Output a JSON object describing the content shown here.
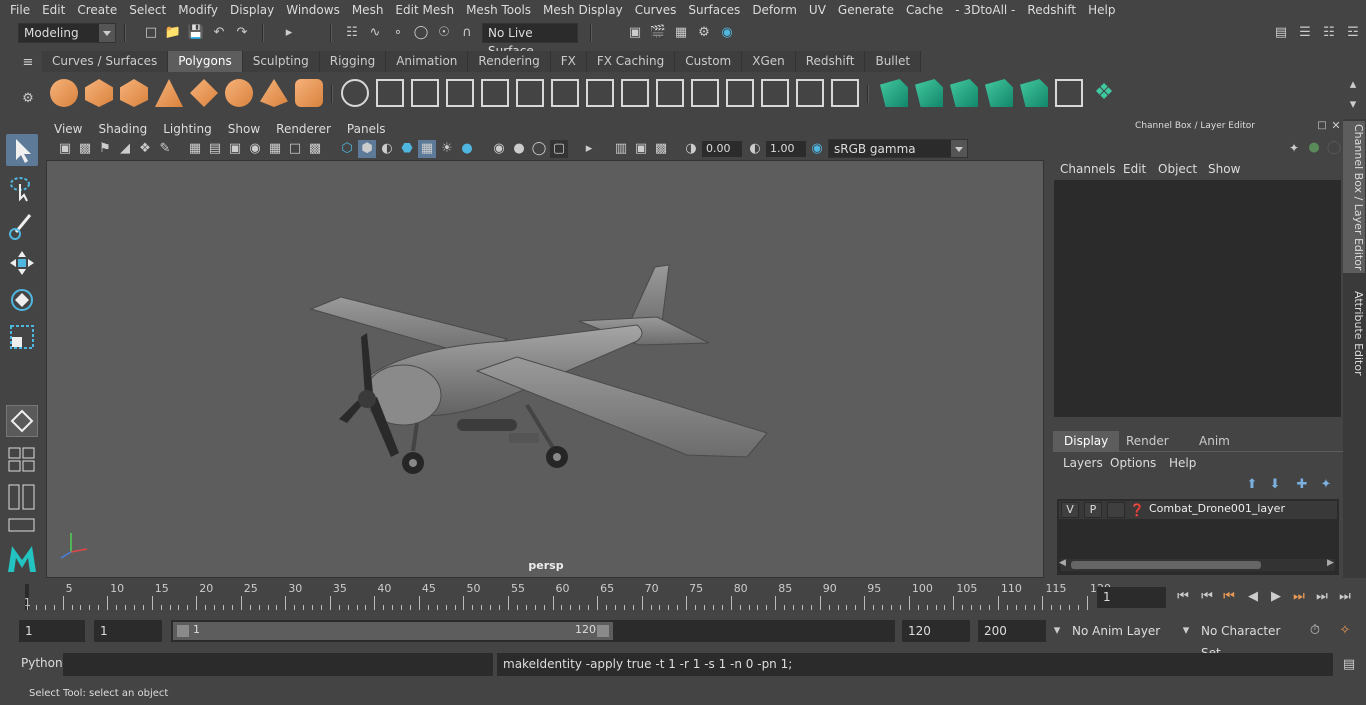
{
  "menubar": {
    "items": [
      "File",
      "Edit",
      "Create",
      "Select",
      "Modify",
      "Display",
      "Windows",
      "Mesh",
      "Edit Mesh",
      "Mesh Tools",
      "Mesh Display",
      "Curves",
      "Surfaces",
      "Deform",
      "UV",
      "Generate",
      "Cache",
      "- 3DtoAll -",
      "Redshift",
      "Help"
    ]
  },
  "statusline": {
    "mode": "Modeling",
    "live_surface": "No Live Surface"
  },
  "shelf": {
    "tabs": [
      "Curves / Surfaces",
      "Polygons",
      "Sculpting",
      "Rigging",
      "Animation",
      "Rendering",
      "FX",
      "FX Caching",
      "Custom",
      "XGen",
      "Redshift",
      "Bullet"
    ],
    "active_tab": "Polygons"
  },
  "viewport": {
    "menu": [
      "View",
      "Shading",
      "Lighting",
      "Show",
      "Renderer",
      "Panels"
    ],
    "exposure": "0.00",
    "gamma": "1.00",
    "color_space": "sRGB gamma",
    "camera_label": "persp"
  },
  "channel_box": {
    "title": "Channel Box / Layer Editor",
    "menu": [
      "Channels",
      "Edit",
      "Object",
      "Show"
    ],
    "display_tabs": [
      "Display",
      "Render",
      "Anim"
    ],
    "active_display_tab": "Display",
    "layer_menu": [
      "Layers",
      "Options",
      "Help"
    ],
    "layer": {
      "v": "V",
      "p": "P",
      "name": "Combat_Drone001_layer"
    }
  },
  "side_tabs": [
    "Channel Box / Layer Editor",
    "Attribute Editor"
  ],
  "timeline": {
    "ticks": [
      5,
      10,
      15,
      20,
      25,
      30,
      35,
      40,
      45,
      50,
      55,
      60,
      65,
      70,
      75,
      80,
      85,
      90,
      95,
      100,
      105,
      110,
      115,
      120
    ],
    "first_label": "1",
    "current_frame": "1"
  },
  "range": {
    "start": "1",
    "playback_start": "1",
    "slider_start": "1",
    "slider_end": "120",
    "playback_end": "120",
    "end": "200",
    "anim_layer": "No Anim Layer",
    "character_set": "No Character Set"
  },
  "command_line": {
    "label": "Python",
    "output": "makeIdentity -apply true -t 1 -r 1 -s 1 -n 0 -pn 1;"
  },
  "help_line": "Select Tool: select an object",
  "colors": {
    "accent": "#5d7a99",
    "shelf_orange": "#e89a55",
    "shelf_green": "#2fb389"
  }
}
